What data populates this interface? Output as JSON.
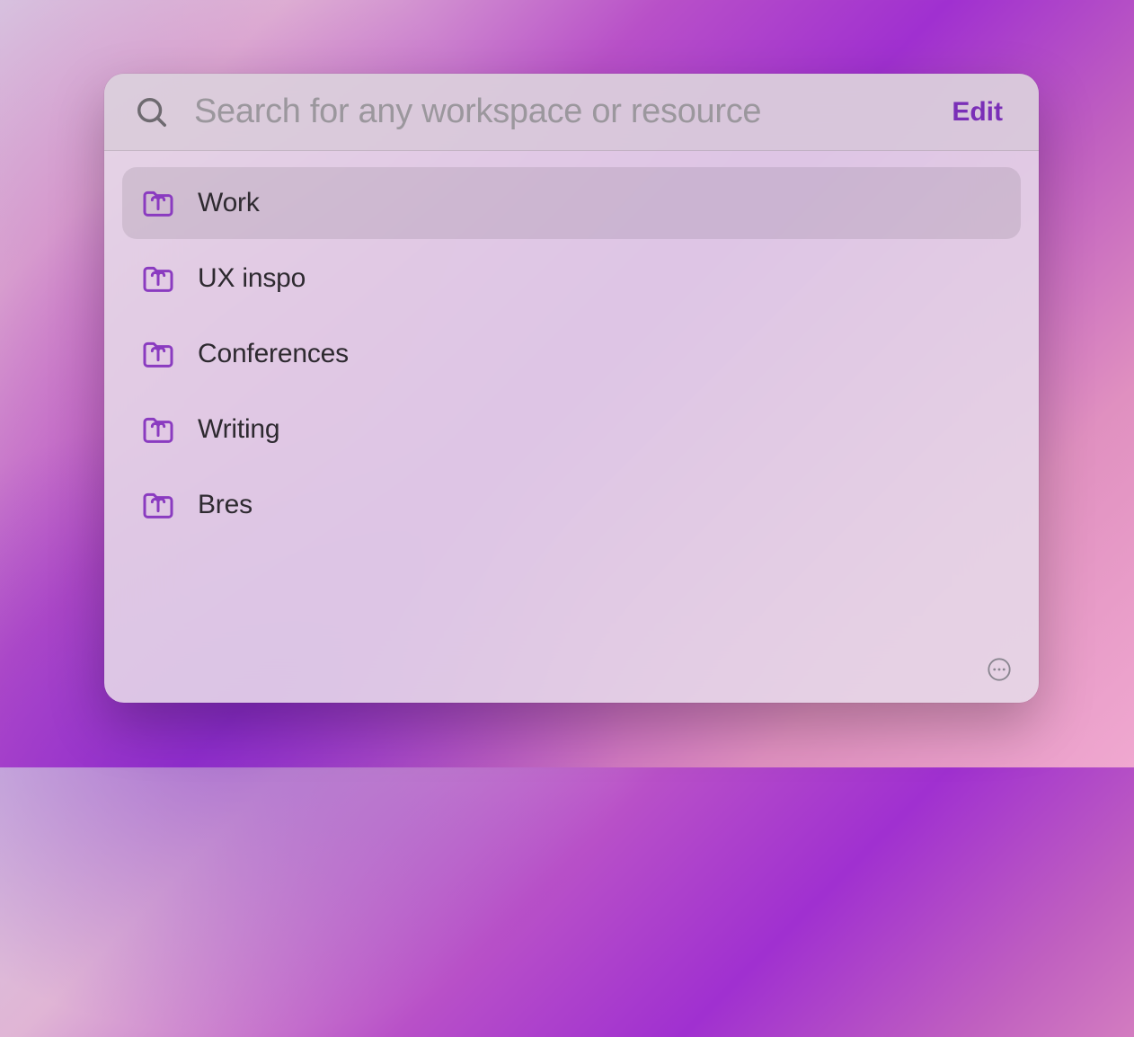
{
  "search": {
    "placeholder": "Search for any workspace or resource",
    "value": ""
  },
  "edit_label": "Edit",
  "colors": {
    "accent": "#7a2fb7",
    "icon_purple": "#8a3bc0"
  },
  "workspaces": [
    {
      "label": "Work",
      "icon": "folder-icon",
      "selected": true
    },
    {
      "label": "UX inspo",
      "icon": "folder-icon",
      "selected": false
    },
    {
      "label": "Conferences",
      "icon": "folder-icon",
      "selected": false
    },
    {
      "label": "Writing",
      "icon": "folder-icon",
      "selected": false
    },
    {
      "label": "Bres",
      "icon": "folder-icon",
      "selected": false
    }
  ]
}
